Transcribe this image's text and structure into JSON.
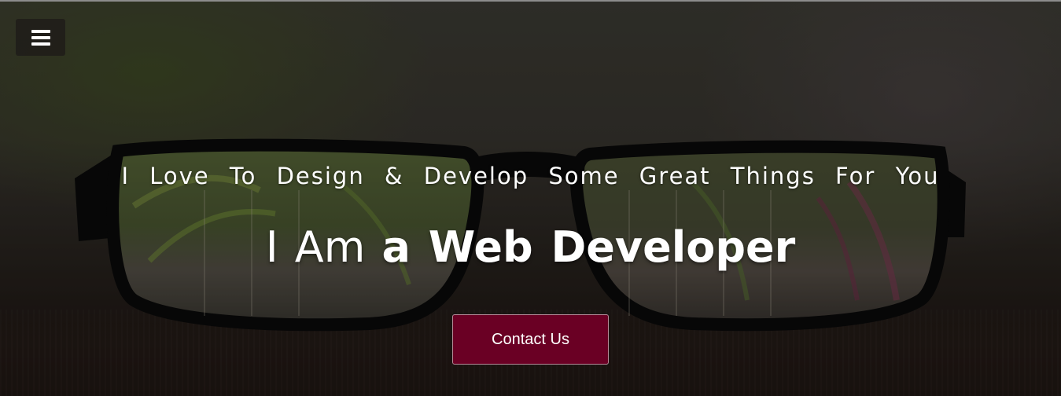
{
  "header": {
    "menu_icon": "hamburger-menu-icon"
  },
  "hero": {
    "tagline": "I Love To Design & Develop Some Great Things For You",
    "headline_prefix": "I Am",
    "headline_emphasis": "a Web Developer",
    "cta_label": "Contact Us",
    "cta_color": "#6a0024",
    "background_image": "eyeglasses-on-table-photo"
  }
}
